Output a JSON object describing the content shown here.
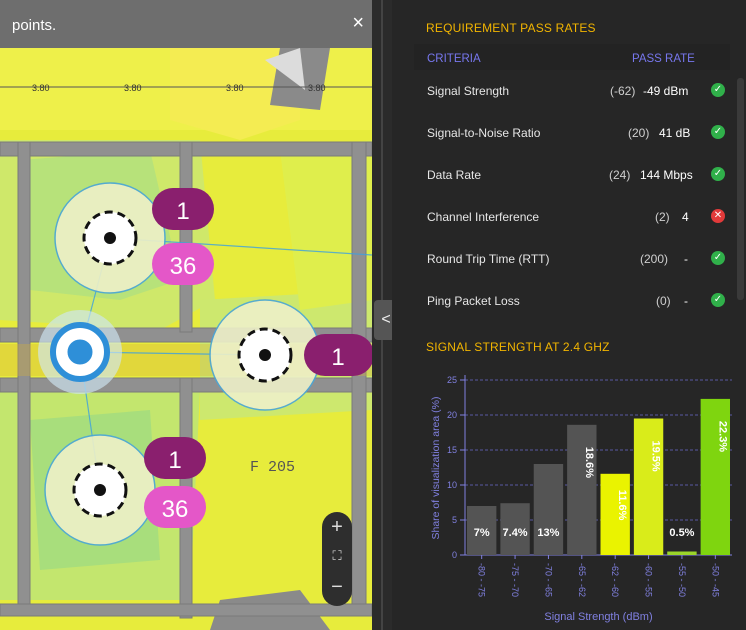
{
  "map": {
    "title": "points.",
    "close_icon": "×",
    "scale_labels": [
      "3.80",
      "3.80",
      "3.80",
      "3.80"
    ],
    "room_label": "F 205",
    "access_points": [
      {
        "badge_top": "1",
        "badge_bottom": "36"
      },
      {
        "badge_top": "1",
        "badge_bottom": ""
      },
      {
        "badge_top": "1",
        "badge_bottom": "36"
      }
    ],
    "zoom": {
      "in": "+",
      "fit": "⛶",
      "out": "−"
    }
  },
  "splitter": {
    "label": "< >"
  },
  "requirements": {
    "title": "REQUIREMENT PASS RATES",
    "col_criteria": "CRITERIA",
    "col_passrate": "PASS RATE",
    "rows": [
      {
        "label": "Signal Strength",
        "required": "(-62)",
        "value": "-49 dBm",
        "status": "pass"
      },
      {
        "label": "Signal-to-Noise Ratio",
        "required": "(20)",
        "value": "41 dB",
        "status": "pass"
      },
      {
        "label": "Data Rate",
        "required": "(24)",
        "value": "144 Mbps",
        "status": "pass"
      },
      {
        "label": "Channel Interference",
        "required": "(2)",
        "value": "4",
        "status": "fail"
      },
      {
        "label": "Round Trip Time (RTT)",
        "required": "(200)",
        "value": "-",
        "status": "pass"
      },
      {
        "label": "Ping Packet Loss",
        "required": "(0)",
        "value": "-",
        "status": "pass"
      }
    ],
    "colors": {
      "pass": "#30b04a",
      "fail": "#e23a3a",
      "accent": "#f2b500"
    }
  },
  "chart_section": {
    "title": "SIGNAL STRENGTH AT 2.4 GHZ"
  },
  "chart_data": {
    "type": "bar",
    "title": "SIGNAL STRENGTH AT 2.4 GHZ",
    "xlabel": "Signal Strength (dBm)",
    "ylabel": "Share of visualization area (%)",
    "ylim": [
      0,
      25
    ],
    "yticks": [
      0,
      5,
      10,
      15,
      20,
      25
    ],
    "categories": [
      "-80 - -75",
      "-75 - -70",
      "-70 - -65",
      "-65 - -62",
      "-62 - -60",
      "-60 - -55",
      "-55 - -50",
      "-50 - -45"
    ],
    "values": [
      7,
      7.4,
      13,
      18.6,
      11.6,
      19.5,
      0.5,
      22.3
    ],
    "labels": [
      "7%",
      "7.4%",
      "13%",
      "18.6%",
      "11.6%",
      "19.5%",
      "0.5%",
      "22.3%"
    ],
    "colors": [
      "#545454",
      "#545454",
      "#545454",
      "#545454",
      "#eaf300",
      "#d9ec1a",
      "#9bd52a",
      "#7fd50f"
    ],
    "grid": true
  }
}
